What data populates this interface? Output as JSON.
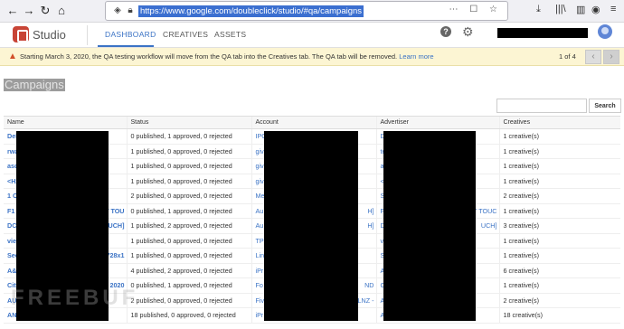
{
  "browser": {
    "url": "https://www.google.com/doubleclick/studio/#qa/campaigns",
    "back_icon": "arrow-left",
    "forward_icon": "arrow-right",
    "reload_icon": "reload",
    "home_icon": "home"
  },
  "header": {
    "brand": "Studio",
    "tabs": [
      {
        "label": "DASHBOARD",
        "active": true
      },
      {
        "label": "CREATIVES",
        "active": false
      },
      {
        "label": "ASSETS",
        "active": false
      }
    ]
  },
  "banner": {
    "message": "Starting March 3, 2020, the QA testing workflow will move from the QA tab into the Creatives tab. The QA tab will be removed.",
    "link": "Learn more",
    "count": "1 of 4",
    "prev": "‹",
    "next": "›"
  },
  "page": {
    "title": "Campaigns"
  },
  "search": {
    "value": "",
    "button": "Search"
  },
  "table": {
    "columns": [
      "Name",
      "Status",
      "Account",
      "Advertiser",
      "Creatives"
    ],
    "rows": [
      {
        "name": "Deh",
        "status": "0 published, 1 approved, 0 rejected",
        "account": "IPC",
        "advertiser": "De",
        "creatives": "1 creative(s)"
      },
      {
        "name": "rwa",
        "status": "1 published, 0 approved, 0 rejected",
        "account": "giv",
        "advertiser": "tes",
        "creatives": "1 creative(s)"
      },
      {
        "name": "asd",
        "status": "1 published, 0 approved, 0 rejected",
        "account": "giv",
        "advertiser": "a",
        "creatives": "1 creative(s)"
      },
      {
        "name": "<H2",
        "status": "1 published, 0 approved, 0 rejected",
        "account": "giv",
        "advertiser": "<h",
        "creatives": "1 creative(s)"
      },
      {
        "name": "1 O",
        "status": "2 published, 0 approved, 0 rejected",
        "account": "Me",
        "advertiser": "Sy",
        "creatives": "2 creative(s)"
      },
      {
        "name": "F1 -",
        "name_tail": "T TOU",
        "status": "0 published, 1 approved, 0 rejected",
        "account": "Au",
        "account_tail": "H]",
        "advertiser": "F1",
        "advertiser_tail": "T TOUC",
        "creatives": "1 creative(s)"
      },
      {
        "name": "DCN",
        "name_tail": "UCH]",
        "status": "1 published, 2 approved, 0 rejected",
        "account": "Au",
        "account_tail": "H]",
        "advertiser": "DC",
        "advertiser_tail": "UCH]",
        "creatives": "3 creative(s)"
      },
      {
        "name": "viev",
        "status": "1 published, 0 approved, 0 rejected",
        "account": "TP",
        "advertiser": "vie",
        "creatives": "1 creative(s)"
      },
      {
        "name": "Sec",
        "name_tail": "_728x1",
        "status": "1 published, 0 approved, 0 rejected",
        "account": "Lin",
        "advertiser": "Se",
        "creatives": "1 creative(s)"
      },
      {
        "name": "A&F",
        "status": "4 published, 2 approved, 0 rejected",
        "account": "iPr",
        "advertiser": "A8",
        "creatives": "6 creative(s)"
      },
      {
        "name": "City",
        "name_tail": "2020",
        "status": "0 published, 1 approved, 0 rejected",
        "account": "Fo",
        "account_tail": "ND",
        "advertiser": "Ci",
        "creatives": "1 creative(s)"
      },
      {
        "name": "AU",
        "status": "2 published, 0 approved, 0 rejected",
        "account": "Fiv",
        "account_tail": "LNZ -",
        "advertiser": "AU",
        "creatives": "2 creative(s)"
      },
      {
        "name": "ANF",
        "status": "18 published, 0 approved, 0 rejected",
        "account": "iPr",
        "advertiser": "AN",
        "creatives": "18 creative(s)"
      }
    ]
  },
  "watermark": "FREEBUF",
  "colors": {
    "accent": "#3b73c5",
    "banner_bg": "#fcf5d3",
    "logo": "#c84436",
    "warning": "#d24f2a"
  }
}
